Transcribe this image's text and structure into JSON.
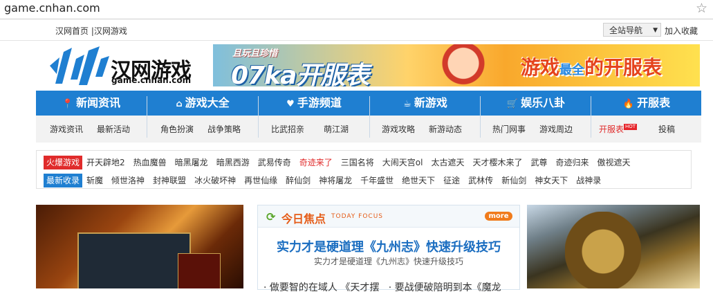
{
  "browser": {
    "url": "game.cnhan.com"
  },
  "top": {
    "links": "汉网首页 |汉网游戏",
    "nav_select": "全站导航",
    "favorite": "加入收藏"
  },
  "logo": {
    "cn": "汉网游戏",
    "en": "game.cnhan.com"
  },
  "banner": {
    "line1": "且玩且珍惜",
    "line2": "07ka开服表",
    "line3a": "游戏",
    "line3b": "最全",
    "line3c": "的开服表"
  },
  "nav": [
    {
      "title": "新闻资讯",
      "icon": "pin-icon",
      "subs": [
        "游戏资讯",
        "最新活动"
      ]
    },
    {
      "title": "游戏大全",
      "icon": "home-icon",
      "subs": [
        "角色扮演",
        "战争策略"
      ]
    },
    {
      "title": "手游频道",
      "icon": "heart-icon",
      "subs": [
        "比武招亲",
        "萌江湖"
      ]
    },
    {
      "title": "新游戏",
      "icon": "cup-icon",
      "subs": [
        "游戏攻略",
        "新游动态"
      ]
    },
    {
      "title": "娱乐八卦",
      "icon": "cart-icon",
      "subs": [
        "热门网事",
        "游戏周边"
      ]
    },
    {
      "title": "开服表",
      "icon": "flame-icon",
      "subs": [
        "开服表",
        "投稿"
      ],
      "hot": "HOT"
    }
  ],
  "hot_games": {
    "label": "火爆游戏",
    "items": [
      "开天辟地2",
      "热血魔兽",
      "暗黑屠龙",
      "暗黑西游",
      "武易传奇",
      "奇迹来了",
      "三国名将",
      "大闹天宫ol",
      "太古遮天",
      "天才樱木来了",
      "武尊",
      "奇迹归来",
      "傲视遮天"
    ],
    "red_item": "奇迹来了"
  },
  "new_games": {
    "label": "最新收录",
    "items": [
      "斩魔",
      "倾世洛神",
      "封神联盟",
      "冰火破坏神",
      "再世仙缘",
      "醉仙剑",
      "神将屠龙",
      "千年盛世",
      "绝世天下",
      "征途",
      "武林传",
      "新仙剑",
      "神女天下",
      "战神录"
    ]
  },
  "focus": {
    "title": "今日焦点",
    "subtitle": "TODAY FOCUS",
    "more": "more",
    "headline": "实力才是硬道理《九州志》快速升级技巧",
    "summary": "实力才是硬道理《九州志》快速升级技巧",
    "cut_left": "· 做要智的在域人 《天才摆",
    "cut_right": "· 要战便破陪明到本《魔龙"
  },
  "colors": {
    "nav_blue": "#1f7fd1",
    "hot_red": "#e02b2b",
    "focus_orange": "#e55c18",
    "headline_blue": "#1a6dc0"
  }
}
